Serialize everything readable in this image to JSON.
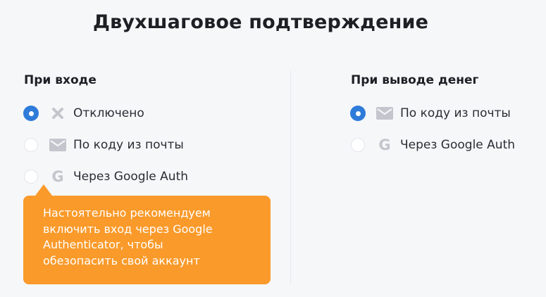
{
  "page": {
    "title": "Двухшаговое подтверждение"
  },
  "login_section": {
    "title": "При входе",
    "options": [
      {
        "label": "Отключено",
        "icon": "close-icon",
        "selected": true
      },
      {
        "label": "По коду из почты",
        "icon": "mail-icon",
        "selected": false
      },
      {
        "label": "Через Google Auth",
        "icon": "google-icon",
        "selected": false
      }
    ]
  },
  "withdraw_section": {
    "title": "При выводе денег",
    "options": [
      {
        "label": "По коду из почты",
        "icon": "mail-icon",
        "selected": true
      },
      {
        "label": "Через Google Auth",
        "icon": "google-icon",
        "selected": false
      }
    ]
  },
  "tooltip": {
    "lines": [
      "Настоятельно рекомендуем",
      "включить вход через Google",
      "Authenticator, чтобы",
      "обезопасить свой аккаунт"
    ]
  },
  "colors": {
    "background": "#f6f7f9",
    "accent": "#2f7bd9",
    "tooltip": "#fa9a2a",
    "icon": "#c3c6cc"
  }
}
